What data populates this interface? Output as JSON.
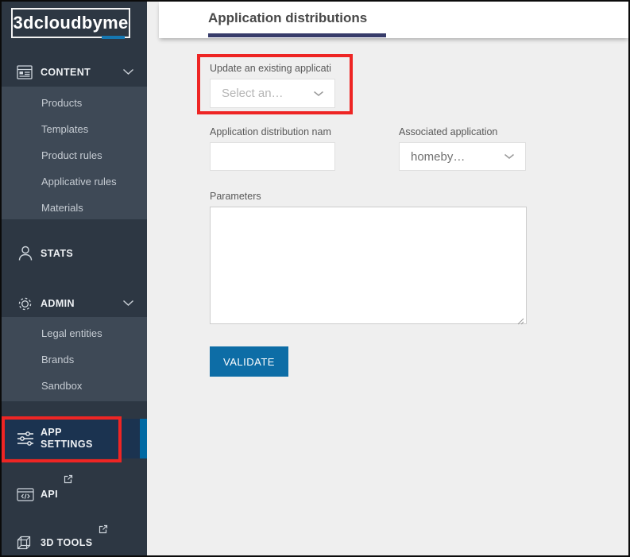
{
  "colors": {
    "sidebar_bg": "#2d3743",
    "submenu_bg": "#3e4956",
    "active_item_bg": "#1b3350",
    "active_item_bar": "#0069a3",
    "logo_accent": "#1577b2",
    "title_underline": "#373c6a",
    "button_blue": "#0d6da6",
    "annotation_red": "#ee2524",
    "main_bg": "#efefef"
  },
  "sidebar": {
    "logo_text": "3dcloudbyme",
    "content_label": "CONTENT",
    "content_submenu": [
      "Products",
      "Templates",
      "Product rules",
      "Applicative rules",
      "Materials"
    ],
    "stats_label": "STATS",
    "admin_label": "ADMIN",
    "admin_submenu": [
      "Legal entities",
      "Brands",
      "Sandbox"
    ],
    "app_settings_label": "APP SETTINGS",
    "api_label": "API",
    "tools_label": "3D TOOLS"
  },
  "header": {
    "title": "Application distributions"
  },
  "form": {
    "update_label": "Update an existing applicati",
    "update_placeholder": "Select an…",
    "name_label": "Application distribution nam",
    "name_value": "",
    "associated_label": "Associated application",
    "associated_value": "homeby…",
    "parameters_label": "Parameters",
    "parameters_value": "",
    "validate_label": "VALIDATE"
  }
}
